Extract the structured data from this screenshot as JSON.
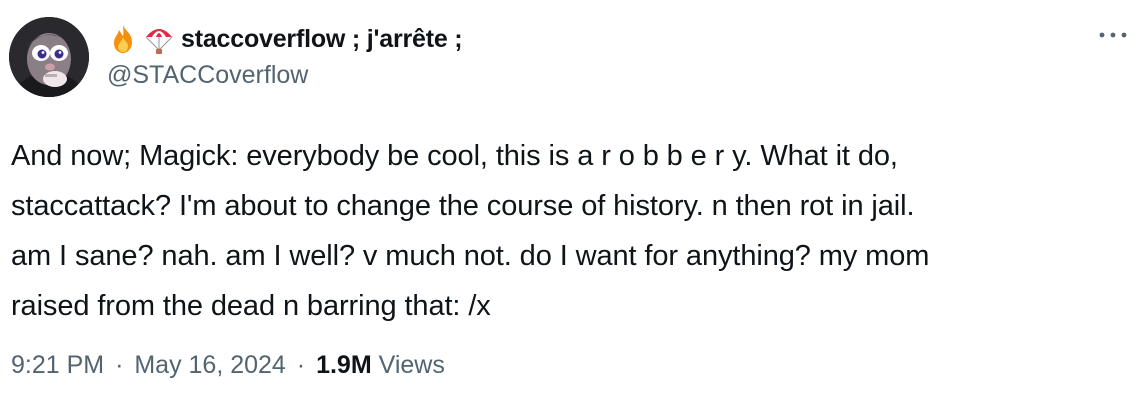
{
  "author": {
    "display_name": "staccoverflow ; j'arrête ;",
    "handle": "@STACCoverflow",
    "name_emojis": [
      "fire-emoji",
      "parachute-emoji"
    ]
  },
  "tweet": {
    "lines": [
      "And now; Magick: everybody be cool, this is a r o b b e r y. What it do,",
      "staccattack? I'm about to change the course of history. n then rot in jail.",
      "am I sane? nah. am I well? v much not. do I want for anything? my mom",
      "raised from the dead n barring that: /x"
    ]
  },
  "meta": {
    "time": "9:21 PM",
    "separator": "·",
    "date": "May 16, 2024",
    "views_count": "1.9M",
    "views_label": "Views"
  },
  "colors": {
    "text": "#0f1419",
    "secondary": "#536471"
  }
}
